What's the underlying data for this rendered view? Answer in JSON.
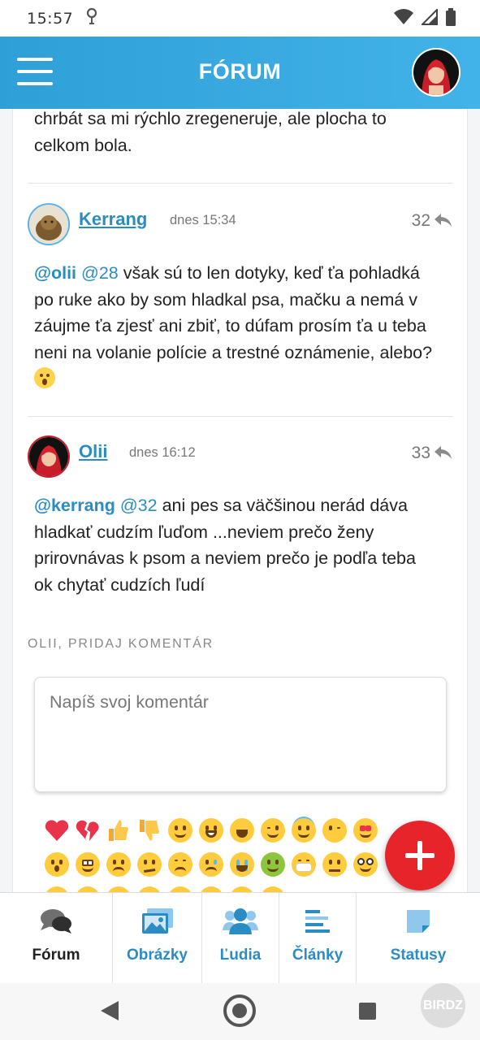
{
  "status_bar": {
    "time": "15:57"
  },
  "header": {
    "title": "FÓRUM"
  },
  "thread": {
    "previous_text": "chrbát sa mi rýchlo zregeneruje, ale plocha to celkom bola.",
    "comments": [
      {
        "user": "Kerrang",
        "time": "dnes 15:34",
        "number": "32",
        "mention_user": "@olii",
        "mention_ref": "@28",
        "text": "však sú to len dotyky, keď ťa pohladká po ruke ako by som hladkal psa, mačku a nemá v záujme ťa zjesť ani zbiť, to dúfam prosím ťa u teba neni na volanie polície a trestné oznámenie, alebo?"
      },
      {
        "user": "Olii",
        "time": "dnes 16:12",
        "number": "33",
        "mention_user": "@kerrang",
        "mention_ref": "@32",
        "text": "ani pes sa väčšinou nerád dáva hladkať cudzím ľuďom ...neviem prečo ženy prirovnávas k psom a neviem prečo je podľa teba ok chytať cudzích ľudí"
      }
    ]
  },
  "comment_form": {
    "label": "OLII, PRIDAJ KOMENTÁR",
    "placeholder": "Napíš svoj komentár"
  },
  "emoji_rows": [
    [
      "heart",
      "broken-heart",
      "thumbs-up",
      "thumbs-down",
      "smile",
      "grin",
      "laugh",
      "wink",
      "angel",
      "kiss",
      "heart-eyes"
    ],
    [
      "surprised",
      "flushed",
      "angry",
      "confused",
      "sad",
      "cry",
      "sob",
      "sick",
      "mask",
      "thinking",
      "nerd"
    ]
  ],
  "bottom_nav": {
    "items": [
      {
        "label": "Fórum",
        "icon": "chat-bubbles-icon"
      },
      {
        "label": "Obrázky",
        "icon": "images-icon"
      },
      {
        "label": "Ľudia",
        "icon": "people-icon"
      },
      {
        "label": "Články",
        "icon": "articles-icon"
      },
      {
        "label": "Statusy",
        "icon": "status-note-icon"
      }
    ]
  },
  "watermark": "BIRDZ",
  "colors": {
    "header": "#3aa9e0",
    "link": "#2b8cc4",
    "fab": "#e8242b"
  }
}
